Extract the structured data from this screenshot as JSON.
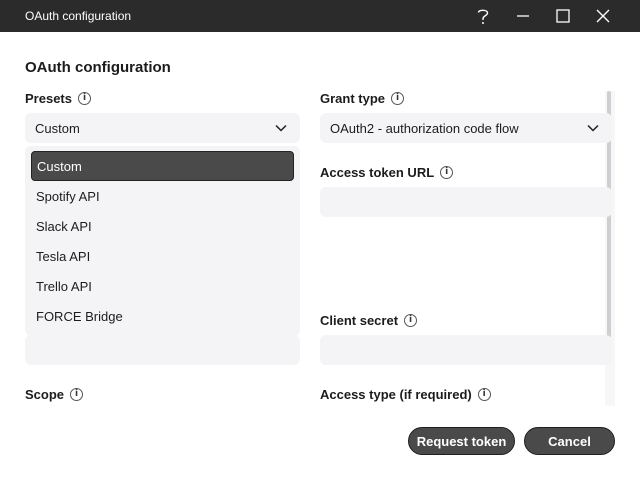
{
  "window": {
    "title": "OAuth configuration",
    "controls": [
      "help-icon",
      "minimize-icon",
      "maximize-icon",
      "close-icon"
    ]
  },
  "dialog": {
    "heading": "OAuth configuration"
  },
  "presets": {
    "label": "Presets",
    "selected": "Custom",
    "options": [
      "Custom",
      "Spotify API",
      "Slack API",
      "Tesla API",
      "Trello API",
      "FORCE Bridge"
    ],
    "selected_index": 0
  },
  "grant_type": {
    "label": "Grant type",
    "selected": "OAuth2 - authorization code flow"
  },
  "access_token_url": {
    "label": "Access token URL",
    "value": ""
  },
  "client_secret": {
    "label": "Client secret",
    "value": ""
  },
  "scope": {
    "label": "Scope"
  },
  "access_type": {
    "label": "Access type (if required)"
  },
  "buttons": {
    "request_token": "Request token",
    "cancel": "Cancel"
  },
  "colors": {
    "titlebar": "#2b2b2b",
    "field_bg": "#f4f4f6",
    "button_bg": "#4a4a4a",
    "selected_option_bg": "#4a4a4a"
  }
}
